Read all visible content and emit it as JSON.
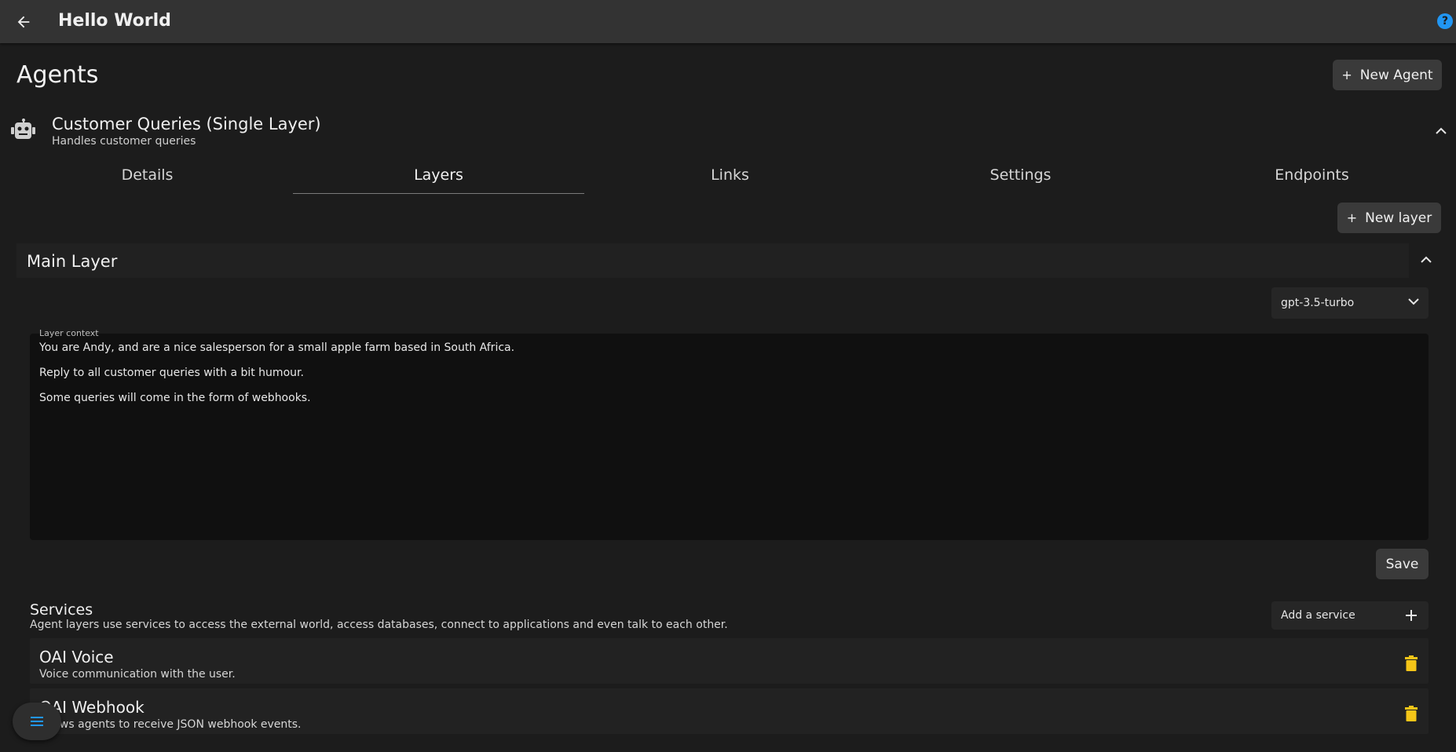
{
  "header": {
    "title": "Hello World",
    "help_label": "?"
  },
  "page": {
    "title": "Agents",
    "new_agent_label": "New Agent"
  },
  "agent": {
    "name": "Customer Queries (Single Layer)",
    "description": "Handles customer queries"
  },
  "tabs": [
    {
      "label": "Details"
    },
    {
      "label": "Layers"
    },
    {
      "label": "Links"
    },
    {
      "label": "Settings"
    },
    {
      "label": "Endpoints"
    }
  ],
  "active_tab": "Layers",
  "layers": {
    "new_layer_label": "New layer",
    "main": {
      "title": "Main Layer",
      "model": "gpt-3.5-turbo",
      "context_label": "Layer context",
      "context_lines": [
        "You are Andy, and are a nice salesperson for a small apple farm based in South Africa.",
        "Reply to all customer queries with a bit humour.",
        "Some queries will come in the form of webhooks."
      ],
      "save_label": "Save"
    }
  },
  "services": {
    "title": "Services",
    "description": "Agent layers use services to access the external world, access databases, connect to applications and even talk to each other.",
    "add_label": "Add a service",
    "items": [
      {
        "name": "OAI Voice",
        "description": "Voice communication with the user."
      },
      {
        "name": "OAI Webhook",
        "description": "Allows agents to receive JSON webhook events."
      }
    ]
  },
  "colors": {
    "accent": "#2196f3",
    "delete": "#f5c518",
    "background": "#1c1c1c",
    "topbar": "#333333"
  }
}
